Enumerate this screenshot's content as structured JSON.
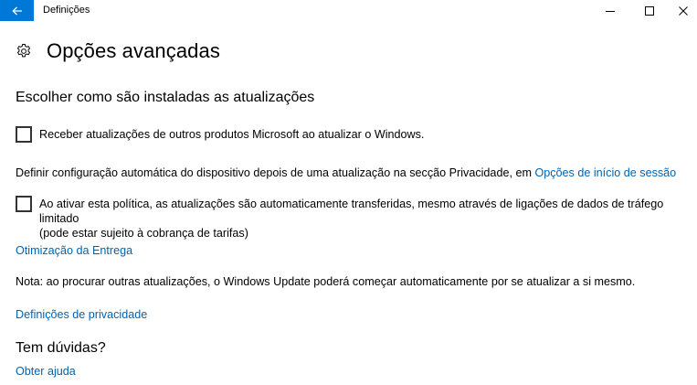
{
  "window": {
    "title": "Definições"
  },
  "page": {
    "title": "Opções avançadas"
  },
  "updates": {
    "heading": "Escolher como são instaladas as atualizações",
    "other_products_checkbox": {
      "label": "Receber atualizações de outros produtos Microsoft ao atualizar o Windows.",
      "checked": false
    },
    "auto_config_text": "Definir configuração automática do dispositivo depois de uma atualização na secção Privacidade, em ",
    "auto_config_link": "Opções de início de sessão",
    "metered_checkbox": {
      "label_line1": "Ao ativar esta política, as atualizações são automaticamente transferidas, mesmo através de ligações de dados de tráfego limitado",
      "label_line2": "(pode estar sujeito à cobrança de tarifas)",
      "checked": false
    },
    "delivery_optimization_link": "Otimização da Entrega",
    "note": "Nota: ao procurar outras atualizações, o Windows Update poderá começar automaticamente por se atualizar a si mesmo.",
    "privacy_settings_link": "Definições de privacidade"
  },
  "help": {
    "heading": "Tem dúvidas?",
    "get_help_link": "Obter ajuda"
  },
  "colors": {
    "accent": "#0078d7",
    "link": "#0063b1"
  },
  "icons": {
    "back": "back-arrow-icon",
    "minimize": "minimize-icon",
    "maximize": "maximize-icon",
    "close": "close-icon",
    "settings": "gear-icon"
  }
}
